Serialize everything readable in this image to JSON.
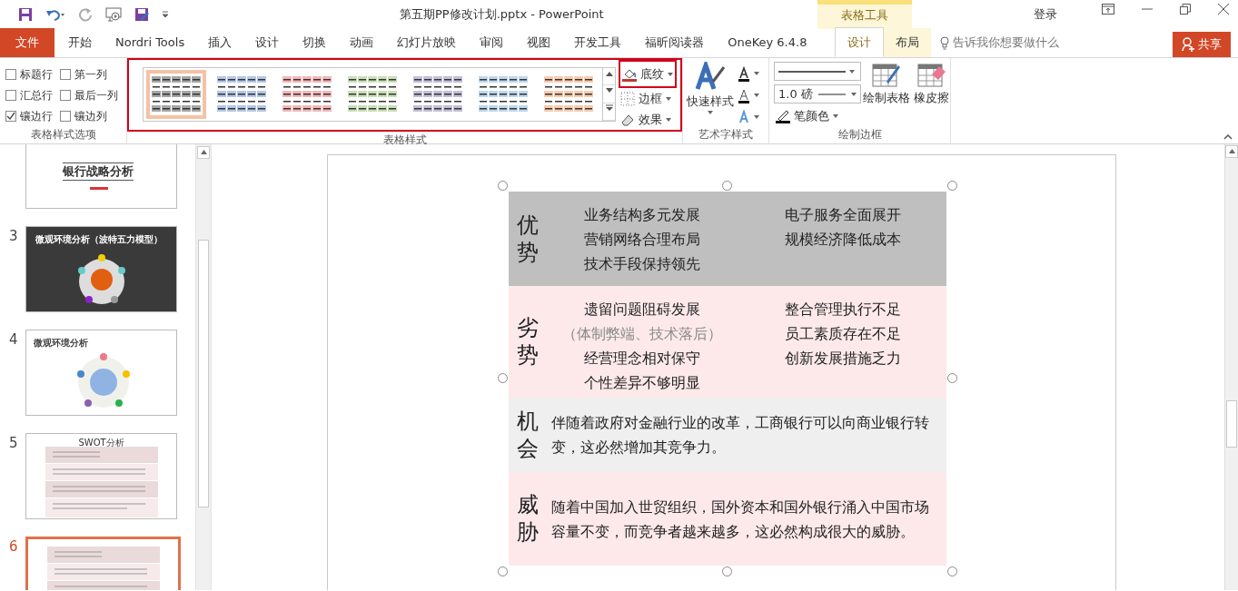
{
  "window": {
    "title": "第五期PP修改计划.pptx  -  PowerPoint",
    "context_group": "表格工具",
    "account": "登录"
  },
  "tabs": [
    {
      "label": "文件",
      "kind": "file",
      "selected": false
    },
    {
      "label": "开始",
      "kind": "normal",
      "selected": false
    },
    {
      "label": "Nordri Tools",
      "kind": "normal",
      "selected": false
    },
    {
      "label": "插入",
      "kind": "normal",
      "selected": false
    },
    {
      "label": "设计",
      "kind": "normal",
      "selected": false
    },
    {
      "label": "切换",
      "kind": "normal",
      "selected": false
    },
    {
      "label": "动画",
      "kind": "normal",
      "selected": false
    },
    {
      "label": "幻灯片放映",
      "kind": "normal",
      "selected": false
    },
    {
      "label": "审阅",
      "kind": "normal",
      "selected": false
    },
    {
      "label": "视图",
      "kind": "normal",
      "selected": false
    },
    {
      "label": "开发工具",
      "kind": "normal",
      "selected": false
    },
    {
      "label": "福昕阅读器",
      "kind": "normal",
      "selected": false
    },
    {
      "label": "OneKey 6.4.8",
      "kind": "normal",
      "selected": false
    },
    {
      "label": "设计",
      "kind": "context",
      "selected": true
    },
    {
      "label": "布局",
      "kind": "context",
      "selected": false
    }
  ],
  "tell_me": {
    "placeholder": "告诉我你想要做什么"
  },
  "share_button": "共享",
  "ribbon": {
    "style_options": {
      "label": "表格样式选项",
      "options": [
        {
          "label": "标题行",
          "checked": false
        },
        {
          "label": "第一列",
          "checked": false
        },
        {
          "label": "汇总行",
          "checked": false
        },
        {
          "label": "最后一列",
          "checked": false
        },
        {
          "label": "镶边行",
          "checked": true
        },
        {
          "label": "镶边列",
          "checked": false
        }
      ]
    },
    "table_styles": {
      "label": "表格样式",
      "styles": [
        {
          "color": "#a6a6a6",
          "selected": true
        },
        {
          "color": "#b4c6e7",
          "selected": false
        },
        {
          "color": "#f4b6b8",
          "selected": false
        },
        {
          "color": "#c9dfb6",
          "selected": false
        },
        {
          "color": "#c3bfd9",
          "selected": false
        },
        {
          "color": "#bdd7ee",
          "selected": false
        },
        {
          "color": "#f8cbad",
          "selected": false
        }
      ],
      "commands": [
        "底纹",
        "边框",
        "效果"
      ]
    },
    "wordart": {
      "label": "艺术字样式",
      "quick_styles": "快速样式"
    },
    "draw_borders": {
      "label": "绘制边框",
      "pen_weight": "1.0 磅",
      "pen_color": "笔颜色",
      "draw_table": "绘制表格",
      "eraser": "橡皮擦"
    }
  },
  "slides": [
    {
      "title": "银行战略分析",
      "kind": "cover",
      "selected": false
    },
    {
      "number": "3",
      "title": "微观环境分析（波特五力模型）",
      "kind": "dark",
      "selected": false
    },
    {
      "number": "4",
      "title": "微观环境分析",
      "kind": "light",
      "selected": false
    },
    {
      "number": "5",
      "title": "SWOT分析",
      "kind": "table",
      "selected": false
    },
    {
      "number": "6",
      "kind": "table",
      "selected": true
    }
  ],
  "table": {
    "rows": [
      {
        "heading": "优势",
        "kind": "columns",
        "color": "#bfbfbf",
        "cells": [
          [
            {
              "text": "业务结构多元发展",
              "muted": false
            },
            {
              "text": "营销网络合理布局",
              "muted": false
            },
            {
              "text": "技术手段保持领先",
              "muted": false
            }
          ],
          [
            {
              "text": "电子服务全面展开",
              "muted": false
            },
            {
              "text": "规模经济降低成本",
              "muted": false
            }
          ]
        ]
      },
      {
        "heading": "劣势",
        "kind": "columns",
        "color": "#fde9ea",
        "cells": [
          [
            {
              "text": "遗留问题阻碍发展",
              "muted": false
            },
            {
              "text": "（体制弊端、技术落后）",
              "muted": true
            },
            {
              "text": "经营理念相对保守",
              "muted": false
            },
            {
              "text": "个性差异不够明显",
              "muted": false
            }
          ],
          [
            {
              "text": "整合管理执行不足",
              "muted": false
            },
            {
              "text": "员工素质存在不足",
              "muted": false
            },
            {
              "text": "创新发展措施乏力",
              "muted": false
            }
          ]
        ]
      },
      {
        "heading": "机会",
        "kind": "paragraph",
        "color": "#efefef",
        "text": "伴随着政府对金融行业的改革，工商银行可以向商业银行转变，这必然增加其竞争力。"
      },
      {
        "heading": "威胁",
        "kind": "paragraph",
        "color": "#fde9ea",
        "text": "随着中国加入世贸组织，国外资本和国外银行涌入中国市场容量不变，而竞争者越来越多，这必然构成很大的威胁。"
      }
    ]
  }
}
